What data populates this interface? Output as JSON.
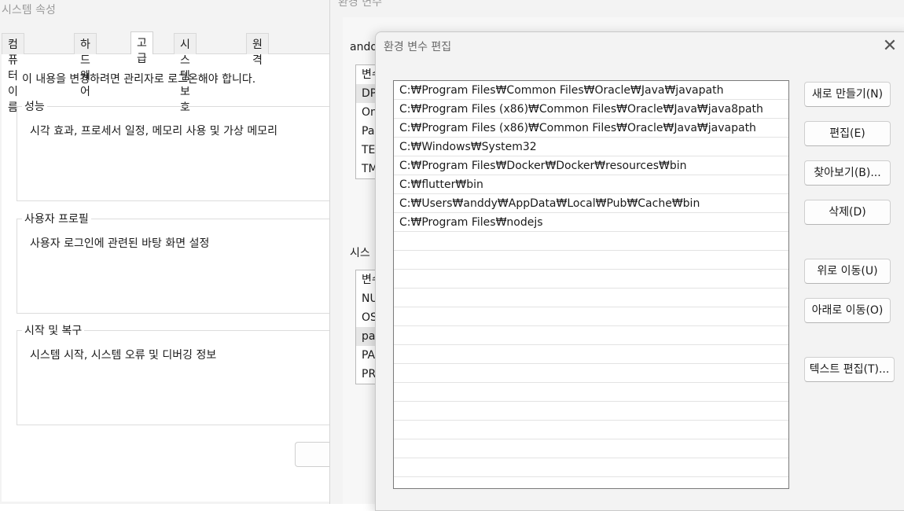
{
  "system_properties": {
    "title": "시스템 속성",
    "tabs": [
      {
        "label": "컴퓨터 이름"
      },
      {
        "label": "하드웨어"
      },
      {
        "label": "고급"
      },
      {
        "label": "시스템 보호"
      },
      {
        "label": "원격"
      }
    ],
    "active_tab": "고급",
    "admin_note": "이 내용을 변경하려면 관리자로 로그온해야 합니다.",
    "groups": [
      {
        "label": "성능",
        "description": "시각 효과, 프로세서 일정, 메모리 사용 및 가상 메모리"
      },
      {
        "label": "사용자 프로필",
        "description": "사용자 로그인에 관련된 바탕 화면 설정"
      },
      {
        "label": "시작 및 복구",
        "description": "시스템 시작, 시스템 오류 및 디버깅 정보"
      }
    ]
  },
  "env_vars_window": {
    "title": "환경 변수",
    "user_section_label": "ando",
    "user_list": [
      "변수",
      "DP",
      "On",
      "Pa",
      "TE",
      "TM"
    ],
    "system_section_label": "시스",
    "system_list": [
      "변수",
      "NU",
      "OS",
      "pa",
      "PA",
      "PR"
    ]
  },
  "edit_dialog": {
    "title": "환경 변수 편집",
    "close_glyph": "✕",
    "paths": [
      "C:₩Program Files₩Common Files₩Oracle₩Java₩javapath",
      "C:₩Program Files (x86)₩Common Files₩Oracle₩Java₩java8path",
      "C:₩Program Files (x86)₩Common Files₩Oracle₩Java₩javapath",
      "C:₩Windows₩System32",
      "C:₩Program Files₩Docker₩Docker₩resources₩bin",
      "C:₩flutter₩bin",
      "C:₩Users₩anddy₩AppData₩Local₩Pub₩Cache₩bin",
      "C:₩Program Files₩nodejs"
    ],
    "buttons": {
      "new": "새로 만들기(N)",
      "edit": "편집(E)",
      "browse": "찾아보기(B)...",
      "delete": "삭제(D)",
      "move_up": "위로 이동(U)",
      "move_down": "아래로 이동(O)",
      "edit_text": "텍스트 편집(T)..."
    }
  }
}
